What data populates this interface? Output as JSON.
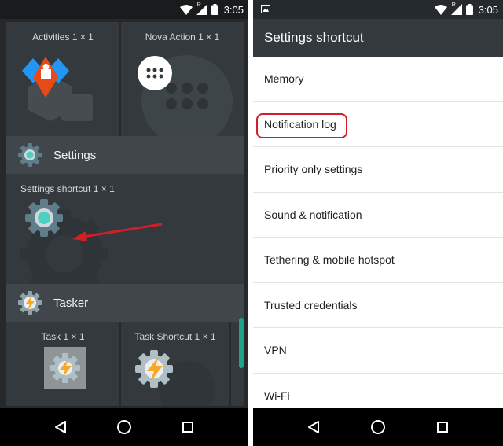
{
  "left_screen": {
    "status_time": "3:05",
    "network_badge": "R",
    "widgets_row1": [
      {
        "label": "Activities  1 × 1",
        "icon": "nova-puzzle-icon"
      },
      {
        "label": "Nova Action  1 × 1",
        "icon": "app-drawer-icon"
      }
    ],
    "section_settings": {
      "label": "Settings",
      "icon": "settings-gear-icon"
    },
    "settings_widget": {
      "label": "Settings shortcut  1 × 1",
      "icon": "settings-gear-icon"
    },
    "section_tasker": {
      "label": "Tasker",
      "icon": "tasker-icon"
    },
    "widgets_row2": [
      {
        "label": "Task  1 × 1",
        "icon": "tasker-task-icon"
      },
      {
        "label": "Task Shortcut  1 × 1",
        "icon": "tasker-icon"
      }
    ],
    "annotation_color": "#d11f27"
  },
  "right_screen": {
    "status_time": "3:05",
    "network_badge": "R",
    "title": "Settings shortcut",
    "items": [
      {
        "label": "Memory"
      },
      {
        "label": "Notification log",
        "highlighted": true
      },
      {
        "label": "Priority only settings"
      },
      {
        "label": "Sound & notification"
      },
      {
        "label": "Tethering & mobile hotspot"
      },
      {
        "label": "Trusted credentials"
      },
      {
        "label": "VPN"
      },
      {
        "label": "Wi-Fi"
      }
    ],
    "highlight_color": "#d11f27"
  },
  "nav": {
    "back": "back-icon",
    "home": "home-icon",
    "recents": "recents-icon"
  }
}
